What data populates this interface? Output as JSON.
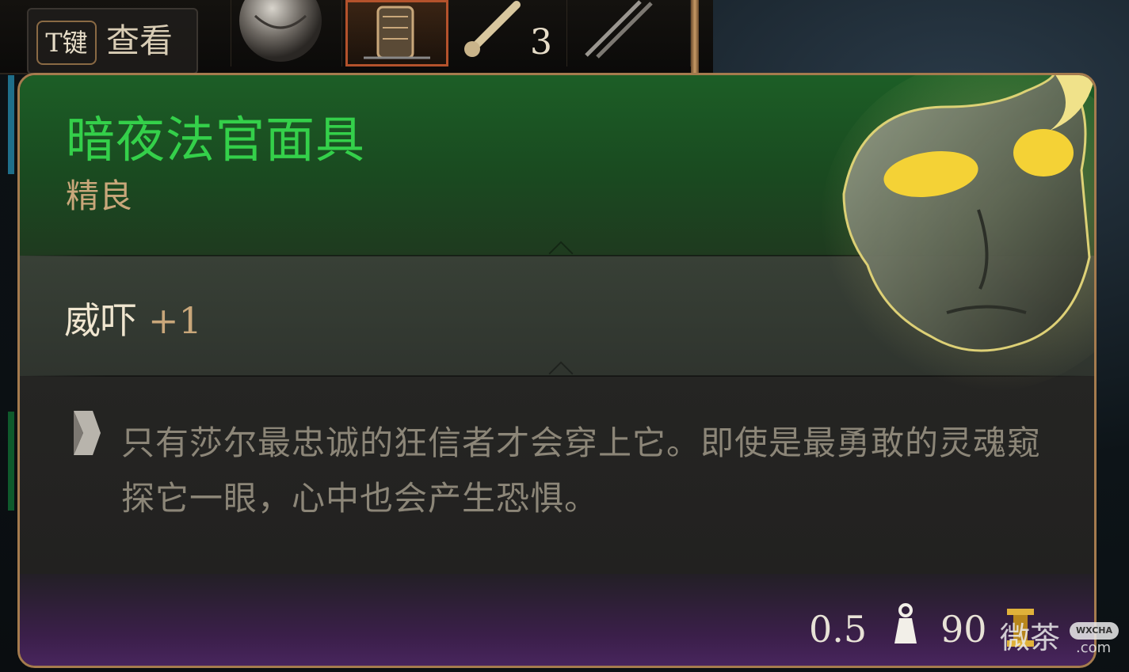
{
  "hotbar": {
    "hint_key": "T键",
    "hint_label": "查看",
    "slots": [
      {
        "icon": "orb-icon"
      },
      {
        "icon": "lantern-icon",
        "selected": true
      },
      {
        "icon": "bone-icon",
        "count": "3"
      },
      {
        "icon": "sticks-icon"
      }
    ]
  },
  "tooltip": {
    "name": "暗夜法官面具",
    "rarity": "精良",
    "stat_name": "威吓",
    "stat_value": "+1",
    "lore_icon": "scroll-icon",
    "lore": "只有莎尔最忠诚的狂信者才会穿上它。即使是最勇敢的灵魂窥探它一眼，心中也会产生恐惧。",
    "weight": "0.5",
    "weight_icon": "weight-icon",
    "value": "90",
    "value_icon": "gold-icon",
    "item_art": "mask-icon"
  },
  "watermark": {
    "text": "微茶",
    "badge": "WXCHA",
    "domain": ".com"
  },
  "colors": {
    "rarity_uncommon": "#34d04a",
    "rarity_label": "#c9a77a",
    "panel_border": "#a57b4e",
    "footer_purple": "#4a2660"
  }
}
